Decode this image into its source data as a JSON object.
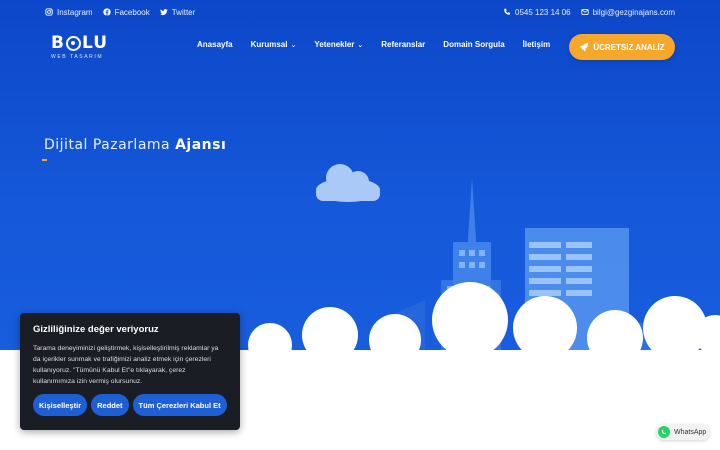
{
  "topbar": {
    "social": [
      {
        "label": "Instagram",
        "icon": "instagram-icon"
      },
      {
        "label": "Facebook",
        "icon": "facebook-icon"
      },
      {
        "label": "Twitter",
        "icon": "twitter-icon"
      }
    ],
    "phone": "0545 123 14 06",
    "email": "bilgi@gezginajans.com"
  },
  "logo": {
    "text_left": "B",
    "text_right": "LU",
    "subtitle": "WEB TASARIM"
  },
  "nav": [
    {
      "label": "Anasayfa",
      "dropdown": false
    },
    {
      "label": "Kurumsal",
      "dropdown": true
    },
    {
      "label": "Yetenekler",
      "dropdown": true
    },
    {
      "label": "Referanslar",
      "dropdown": false
    },
    {
      "label": "Domain Sorgula",
      "dropdown": false
    },
    {
      "label": "İletişim",
      "dropdown": false
    }
  ],
  "cta": {
    "label": "ÜCRETSİZ ANALİZ",
    "icon": "rocket-icon"
  },
  "hero": {
    "light": "Dijital  Pazarlama ",
    "bold": "Ajansı"
  },
  "cookie": {
    "title": "Gizliliğinize değer veriyoruz",
    "text": "Tarama deneyiminizi geliştirmek, kişiselleştirilmiş reklamlar ya da içerikler sunmak ve trafiğimizi analiz etmek için çerezleri kullanıyoruz. \"Tümünü Kabul Et\"e tıklayarak, çerez kullanımımıza izin vermiş olursunuz.",
    "buttons": {
      "customize": "Kişiselleştir",
      "reject": "Reddet",
      "accept_all": "Tüm Çerezleri Kabul Et"
    }
  },
  "whatsapp": {
    "label": "WhatsApp"
  },
  "colors": {
    "primary": "#1558d9",
    "accent": "#f7a82a",
    "cookie_bg": "#1a1d24",
    "button": "#1f5fd6"
  }
}
